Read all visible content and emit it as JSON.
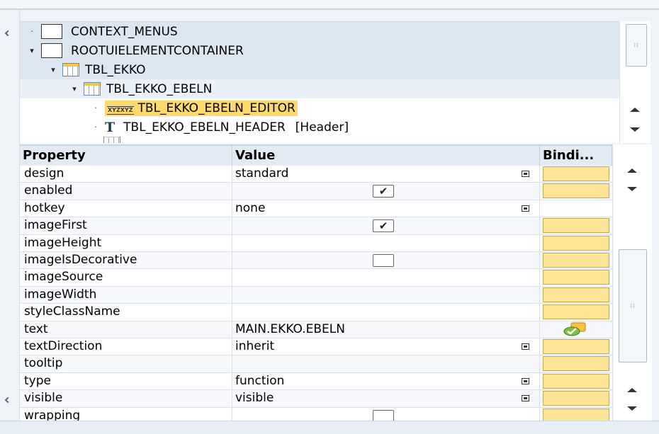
{
  "tree": {
    "nodes": [
      {
        "label": "CONTEXT_MENUS",
        "toggle": "·",
        "icon": "element-box-icon"
      },
      {
        "label": "ROOTUIELEMENTCONTAINER",
        "toggle": "▾",
        "icon": "element-box-icon"
      },
      {
        "label": "TBL_EKKO",
        "toggle": "▾",
        "icon": "table-icon"
      },
      {
        "label": "TBL_EKKO_EBELN",
        "toggle": "▾",
        "icon": "table-column-icon"
      },
      {
        "label": "TBL_EKKO_EBELN_EDITOR",
        "toggle": "·",
        "icon": "input-field-icon",
        "selected": true
      },
      {
        "label": "TBL_EKKO_EBELN_HEADER",
        "suffix": "[Header]",
        "toggle": "·",
        "icon": "text-view-icon"
      }
    ],
    "input_icon_text": "XYZXYZ",
    "text_icon_glyph": "T"
  },
  "grid": {
    "headers": {
      "property": "Property",
      "value": "Value",
      "binding": "Bindi..."
    },
    "rows": [
      {
        "property": "design",
        "value": "standard",
        "dropdown": true,
        "binding": "empty"
      },
      {
        "property": "enabled",
        "value": "",
        "checkbox": "checked",
        "binding": "empty"
      },
      {
        "property": "hotkey",
        "value": "none",
        "dropdown": true,
        "binding": "none"
      },
      {
        "property": "imageFirst",
        "value": "",
        "checkbox": "checked",
        "binding": "empty"
      },
      {
        "property": "imageHeight",
        "value": "",
        "binding": "empty"
      },
      {
        "property": "imageIsDecorative",
        "value": "",
        "checkbox": "unchecked",
        "binding": "empty"
      },
      {
        "property": "imageSource",
        "value": "",
        "binding": "empty"
      },
      {
        "property": "imageWidth",
        "value": "",
        "binding": "empty"
      },
      {
        "property": "styleClassName",
        "value": "",
        "binding": "empty"
      },
      {
        "property": "text",
        "value": "MAIN.EKKO.EBELN",
        "binding": "bound"
      },
      {
        "property": "textDirection",
        "value": "inherit",
        "dropdown": true,
        "binding": "empty"
      },
      {
        "property": "tooltip",
        "value": "",
        "binding": "empty"
      },
      {
        "property": "type",
        "value": "function",
        "dropdown": true,
        "binding": "empty"
      },
      {
        "property": "visible",
        "value": "visible",
        "dropdown": true,
        "binding": "empty"
      },
      {
        "property": "wrapping",
        "value": "",
        "checkbox": "unchecked",
        "binding": "empty"
      }
    ],
    "checkmark": "✔"
  },
  "colors": {
    "selection": "#ffd96b",
    "binding_cell": "#fde595",
    "header_bg": "#e2eaf3"
  }
}
